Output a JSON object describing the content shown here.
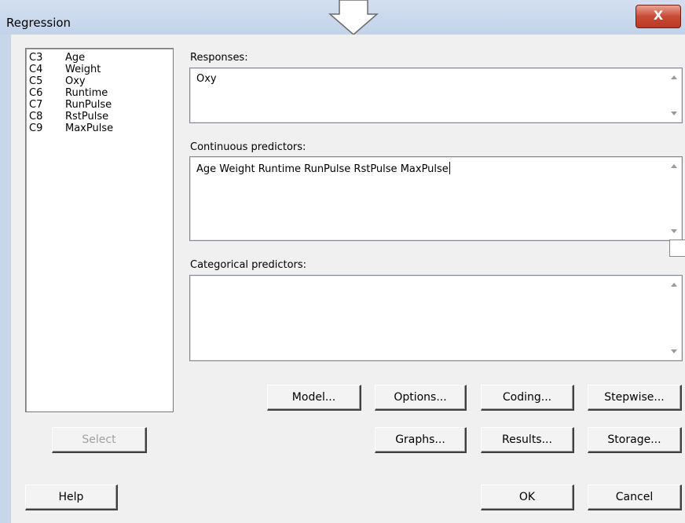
{
  "window": {
    "title": "Regression",
    "close_glyph": "X"
  },
  "variables": [
    {
      "col": "C3",
      "name": "Age"
    },
    {
      "col": "C4",
      "name": "Weight"
    },
    {
      "col": "C5",
      "name": "Oxy"
    },
    {
      "col": "C6",
      "name": "Runtime"
    },
    {
      "col": "C7",
      "name": "RunPulse"
    },
    {
      "col": "C8",
      "name": "RstPulse"
    },
    {
      "col": "C9",
      "name": "MaxPulse"
    }
  ],
  "responses": {
    "label": "Responses:",
    "value": "Oxy"
  },
  "continuous": {
    "label": "Continuous predictors:",
    "value": "Age Weight Runtime RunPulse RstPulse MaxPulse"
  },
  "categorical": {
    "label": "Categorical predictors:",
    "value": ""
  },
  "buttons": {
    "model": "Model...",
    "options": "Options...",
    "coding": "Coding...",
    "stepwise": "Stepwise...",
    "select": "Select",
    "graphs": "Graphs...",
    "results": "Results...",
    "storage": "Storage...",
    "help": "Help",
    "ok": "OK",
    "cancel": "Cancel"
  }
}
